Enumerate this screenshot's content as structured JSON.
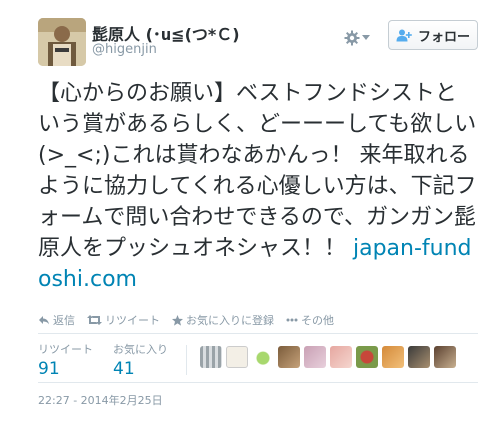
{
  "user": {
    "display_name": "髭原人 (･ս≦(つ*Ｃ)",
    "handle": "@higenjin"
  },
  "header": {
    "gear_icon": "gear-icon",
    "follow_label": "フォロー",
    "follow_icon": "person-plus-icon"
  },
  "tweet": {
    "text": "【心からのお願い】ベストフンドシストという賞があるらしく、どーーーしても欲しい(>_<;)これは貰わなあかんっ！ 来年取れるように協力してくれる心優しい方は、下記フォームで問い合わせできるので、ガンガン髭原人をプッシュオネシャス！！ ",
    "link": "japan-fundoshi.com"
  },
  "actions": {
    "reply": "返信",
    "retweet": "リツイート",
    "favorite": "お気に入りに登録",
    "more": "その他"
  },
  "stats": {
    "retweets_label": "リツイート",
    "retweets_count": "91",
    "favorites_label": "お気に入り",
    "favorites_count": "41"
  },
  "timestamp": "22:27 - 2014年2月25日",
  "colors": {
    "link": "#0084b4",
    "muted": "#8899a6",
    "text": "#292f33"
  }
}
